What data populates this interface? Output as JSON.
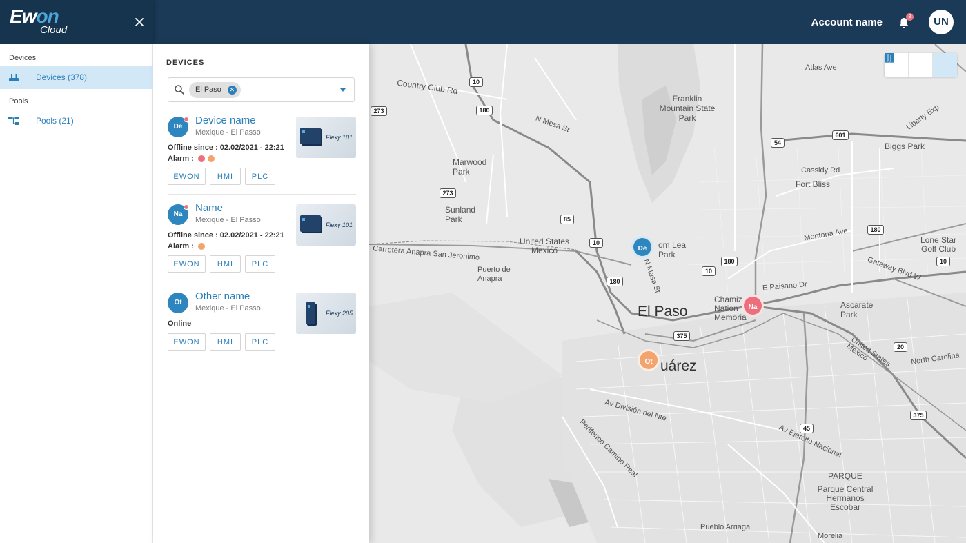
{
  "brand": {
    "logo_main": "Ewon",
    "logo_sub": "Cloud"
  },
  "topbar": {
    "account_name": "Account name",
    "notification_count": "3",
    "user_initials": "UN"
  },
  "sidebar": {
    "section_devices": "Devices",
    "item_devices": "Devices (378)",
    "section_pools": "Pools",
    "item_pools": "Pools (21)"
  },
  "panel": {
    "title": "DEVICES",
    "filter_chip": "El Paso"
  },
  "devices": [
    {
      "initials": "De",
      "name": "Device name",
      "location": "Mexique - El Passo",
      "status": "Offline since : 02.02/2021 - 22:21",
      "alarm_label": "Alarm :",
      "alarm_colors": [
        "#ec6f7c",
        "#f2a46e"
      ],
      "model": "Flexy 101",
      "btn1": "EWON",
      "btn2": "HMI",
      "btn3": "PLC"
    },
    {
      "initials": "Na",
      "name": "Name",
      "location": "Mexique - El Passo",
      "status": "Offline since : 02.02/2021 - 22:21",
      "alarm_label": "Alarm :",
      "alarm_colors": [
        "#f2a46e"
      ],
      "model": "Flexy 101",
      "btn1": "EWON",
      "btn2": "HMI",
      "btn3": "PLC"
    },
    {
      "initials": "Ot",
      "name": "Other name",
      "location": "Mexique - El Passo",
      "status": "Online",
      "model": "Flexy 205",
      "btn1": "EWON",
      "btn2": "HMI",
      "btn3": "PLC"
    }
  ],
  "map": {
    "labels": {
      "el_paso": "El Paso",
      "juarez": "uárez",
      "franklin": "Franklin Mountain State Park",
      "marwood": "Marwood Park",
      "sunland": "Sunland Park",
      "anapra": "Puerto de Anapra",
      "us_mx": "United States Mexico",
      "us_mx2": "United States Mexico",
      "chamizal": "Chamiz Nation Memoria",
      "ascarate": "Ascarate Park",
      "parque": "PARQUE",
      "parque_central": "Parque Central Hermanos Escobar",
      "biggs": "Biggs Park",
      "fort_bliss": "Fort Bliss",
      "lone_star": "Lone Star Golf Club",
      "cassidy": "Cassidy Rd",
      "atlas": "Atlas Ave",
      "country_club": "Country Club Rd",
      "mesa": "N Mesa St",
      "mesa2": "N Mesa St",
      "montana": "Montana Ave",
      "carretera": "Carretera Anapra San Jeronimo",
      "paisano": "E Paisano Dr",
      "division": "Av División del Nte",
      "ejercito": "Av Ejercito Nacional",
      "camino_real": "Periferico Camino Real",
      "pomlea": "om Lea Park",
      "north_carolina": "North Carolina",
      "pueblo": "Pueblo Arriaga",
      "morelia": "Morelia",
      "gateway": "Gateway Blvd W",
      "liberty": "Liberty Exp"
    },
    "shields": [
      "10",
      "180",
      "273",
      "85",
      "10",
      "180",
      "375",
      "54",
      "601",
      "180",
      "10",
      "20",
      "375",
      "45",
      "180",
      "273",
      "10"
    ],
    "markers": [
      {
        "label": "De",
        "color": "#2e86bf"
      },
      {
        "label": "Na",
        "color": "#ec6f7c"
      },
      {
        "label": "Ot",
        "color": "#f2a46e"
      }
    ]
  }
}
